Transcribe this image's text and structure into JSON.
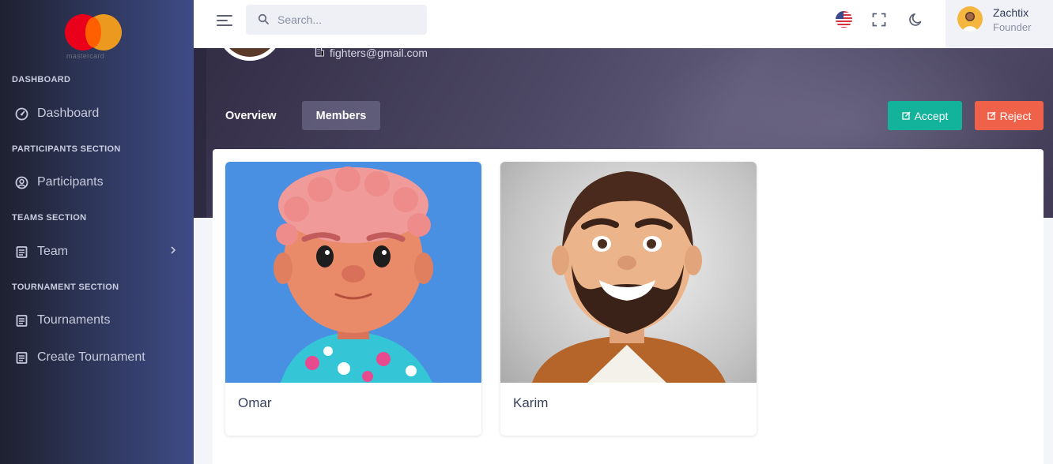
{
  "brand": {
    "name": "mastercard"
  },
  "sidebar": {
    "sections": [
      {
        "title": "DASHBOARD",
        "items": [
          {
            "label": "Dashboard",
            "icon": "gauge-icon"
          }
        ]
      },
      {
        "title": "PARTICIPANTS SECTION",
        "items": [
          {
            "label": "Participants",
            "icon": "user-circle-icon"
          }
        ]
      },
      {
        "title": "TEAMS SECTION",
        "items": [
          {
            "label": "Team",
            "icon": "document-icon",
            "has_submenu": true
          }
        ]
      },
      {
        "title": "TOURNAMENT SECTION",
        "items": [
          {
            "label": "Tournaments",
            "icon": "document-icon"
          },
          {
            "label": "Create Tournament",
            "icon": "document-icon"
          }
        ]
      }
    ]
  },
  "topbar": {
    "search": {
      "placeholder": "Search...",
      "value": ""
    },
    "language_flag": "us-flag-icon",
    "user": {
      "name": "Zachtix",
      "role": "Founder"
    }
  },
  "profile": {
    "email": "fighters@gmail.com",
    "tabs": [
      {
        "label": "Overview",
        "active": false
      },
      {
        "label": "Members",
        "active": true
      }
    ],
    "actions": {
      "accept": "Accept",
      "reject": "Reject"
    }
  },
  "members": [
    {
      "name": "Omar",
      "photo_bg": "#4a90e2"
    },
    {
      "name": "Karim",
      "photo_bg": "#c9c9c9"
    }
  ],
  "colors": {
    "accept": "#13b39b",
    "reject": "#f0614a",
    "sidebar_accent": "#3e4b86"
  }
}
